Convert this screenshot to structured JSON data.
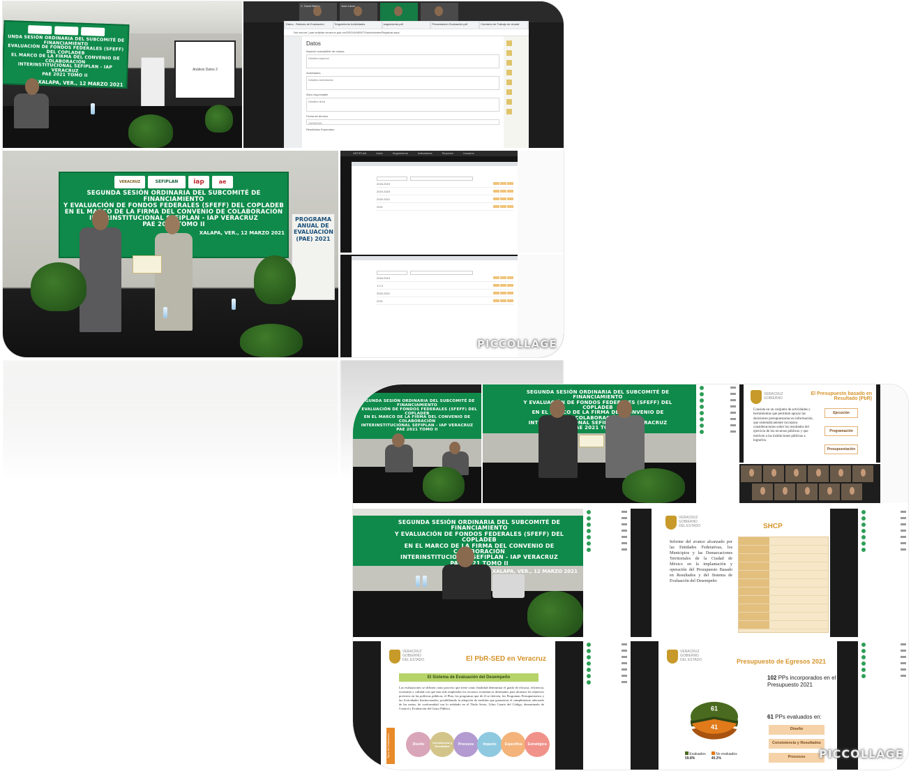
{
  "collage_top": {
    "watermark": "PICCOLLAGE",
    "photo_event_1": {
      "banner_lines": [
        "UNDA SESIÓN ORDINARIA DEL SUBCOMITÉ DE FINANCIAMIENTO",
        "EVALUACIÓN DE FONDOS FEDERALES (SFEFF) DEL COPLADEB",
        "EL MARCO DE LA FIRMA DEL CONVENIO DE COLABORACIÓN",
        "INTERINSTITUCIONAL SEFIPLAN - IAP VERACRUZ",
        "PAE 2021 TOMO II"
      ],
      "place": "XALAPA, VER., 12 MARZO 2021",
      "screen_text": "Análisis Datos 2"
    },
    "form_window": {
      "participants": [
        "C. David Baltaz...",
        "Juan Lauro",
        "",
        ""
      ],
      "tabs": [
        "Datos - Sistema de Evaluación",
        "Seguimiento Actividades",
        "seguimiento.pdf",
        "Presentación Evaluación.pdf",
        "Comisión de Trabajo de ciudad"
      ],
      "url": "Not secure | pae.sefiplan.veracruz.gob.mx/SEGUIMIENTO/actividades/Registrar.aspx",
      "heading": "Datos",
      "fields": [
        {
          "label": "Aspecto susceptible de mejora",
          "value": "Detalles Aspecto"
        },
        {
          "label": "Actividades",
          "value": "Detalles Actividades"
        },
        {
          "label": "Área responsable",
          "value": "Detalles Área"
        },
        {
          "label": "Fecha de término",
          "value": "13/03/2021"
        },
        {
          "label": "Resultados Esperados",
          "value": ""
        }
      ]
    },
    "photo_event_2": {
      "banner_lines": [
        "SEGUNDA SESIÓN ORDINARIA DEL SUBCOMITÉ DE FINANCIAMIENTO",
        "Y EVALUACIÓN DE FONDOS FEDERALES (SFEFF) DEL COPLADEB",
        "EN EL MARCO DE LA FIRMA DEL CONVENIO DE COLABORACIÓN",
        "INTERINSTITUCIONAL SEFIPLAN - IAP VERACRUZ",
        "PAE 2021 TOMO II"
      ],
      "place": "XALAPA, VER., 12 MARZO 2021",
      "logos": [
        "VERACRUZ",
        "SEFIPLAN",
        "iap",
        "ae"
      ],
      "stand_lines": [
        "PROGRAMA",
        "ANUAL DE",
        "EVALUACIÓN",
        "(PAE) 2021"
      ]
    },
    "app_window_1": {
      "menu": [
        "SEFIPLAN",
        "Inicio",
        "Seguimiento",
        "Indicadores",
        "Reportes",
        "Usuarios"
      ],
      "rows": [
        "2018-2019",
        "2019-2020",
        "2020-2021",
        "2021"
      ]
    },
    "app_window_2": {
      "rows": [
        "2018-2019",
        "1.2.3",
        "2020-2021",
        "2021"
      ]
    }
  },
  "collage_bottom": {
    "watermark": "PICCOLLAGE",
    "banner_lines": [
      "SEGUNDA SESIÓN ORDINARIA DEL SUBCOMITÉ DE FINANCIAMIENTO",
      "Y EVALUACIÓN DE FONDOS FEDERALES (SFEFF) DEL COPLADEB",
      "EN EL MARCO DE LA FIRMA DEL CONVENIO DE COLABORACIÓN",
      "INTERINSTITUCIONAL SEFIPLAN - IAP VERACRUZ",
      "PAE 2021 TOMO II"
    ],
    "place": "XALAPA, VER., 12 MARZO 2021",
    "gov_logo": [
      "VERACRUZ",
      "GOBIERNO",
      "DEL ESTADO"
    ],
    "slide_pbr": {
      "title": "El Presupuesto basado en Resultado (PbR)",
      "body": "Consiste en un conjunto de actividades y herramientas que permiten apoyar las decisiones presupuestarias en información, que sistemáticamente incorpora consideraciones sobre los resultados del ejercicio de los recursos públicos y que motiven a las instituciones públicas a lograrlos.",
      "steps": [
        "Ejecución",
        "Programación",
        "Presupuestación"
      ]
    },
    "slide_shcp": {
      "title": "SHCP",
      "body": "Informe del avance alcanzado por las Entidades Federativas, los Municipios y las Demarcaciones Territoriales de la Ciudad de México en la implantación y operación del Presupuesto Basado en Resultados y del Sistema de Evaluación del Desempeño"
    },
    "slide_sed": {
      "title": "El PbR-SED en Veracruz",
      "subtitle": "El Sistema de Evaluación del Desempeño",
      "body": "Las evaluaciones se definen como proceso que tiene como finalidad determinar el grado de eficacia, eficiencia, economía y calidad con que han sido empleados los recursos económicos destinados para alcanzar los objetivos previstos en las políticas públicas, el Plan, los programas que de él se deriven, los Programas Presupuestarios y las Actividades Institucionales, posibilitando la adopción de medidas que garanticen el cumplimiento adecuado de las metas, de conformidad con lo señalado en el Título Sexto, Libro Cuarto del Código, denominado de Control y Evaluación del Gasto Público.",
      "side_label": "Tipos de Evaluación",
      "circles": [
        "Diseño",
        "Consistencia y Resultados",
        "Procesos",
        "Impacto",
        "Específica",
        "Estratégica"
      ]
    },
    "slide_pe": {
      "title": "Presupuesto de Egresos 2021",
      "headline_num": "102",
      "headline": "PPs incorporados en el Presupuesto 2021",
      "evaluated_num": "61",
      "evaluated_label": "PPs evaluados en:",
      "boxes": [
        "Diseño",
        "Consistencia y Resultados",
        "Procesos"
      ],
      "legend": [
        {
          "label": "Evaluados",
          "pct": "59.8%",
          "color": "#4a6b1f"
        },
        {
          "label": "No evaluados",
          "pct": "40.2%",
          "color": "#e07a1a"
        }
      ]
    }
  },
  "chart_data": {
    "type": "pie",
    "title": "Presupuesto de Egresos 2021",
    "slices": [
      {
        "label": "Evaluados",
        "value": 61,
        "pct": 59.8,
        "color": "#4a6b1f"
      },
      {
        "label": "No evaluados",
        "value": 41,
        "pct": 40.2,
        "color": "#e07a1a"
      }
    ],
    "legend": "bottom"
  }
}
